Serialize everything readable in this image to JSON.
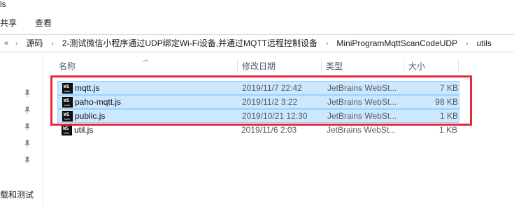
{
  "window": {
    "title_fragment": "ls"
  },
  "ribbon": {
    "tabs": [
      "共享",
      "查看"
    ]
  },
  "address_bar": {
    "back_glyph": "«",
    "crumbs": [
      "源码",
      "2-测试微信小程序通过UDP绑定Wi-Fi设备,并通过MQTT远程控制设备",
      "MiniProgramMqttScanCodeUDP",
      "utils"
    ]
  },
  "nav_pane": {
    "label": "载和测试"
  },
  "columns": {
    "name": "名称",
    "date": "修改日期",
    "type": "类型",
    "size": "大小"
  },
  "files": [
    {
      "name": "mqtt.js",
      "date": "2019/11/7 22:42",
      "type": "JetBrains WebSt...",
      "size": "7 KB",
      "selected": true
    },
    {
      "name": "paho-mqtt.js",
      "date": "2019/11/2 3:22",
      "type": "JetBrains WebSt...",
      "size": "98 KB",
      "selected": true
    },
    {
      "name": "public.js",
      "date": "2019/10/21 12:30",
      "type": "JetBrains WebSt...",
      "size": "1 KB",
      "selected": true
    },
    {
      "name": "util.js",
      "date": "2019/11/6 2:03",
      "type": "JetBrains WebSt...",
      "size": "1 KB",
      "selected": false
    }
  ],
  "file_icon_text": "WS",
  "colors": {
    "selection_bg": "#cce8ff",
    "selection_border": "#99d1ff",
    "annotation_box": "#e8283a"
  }
}
